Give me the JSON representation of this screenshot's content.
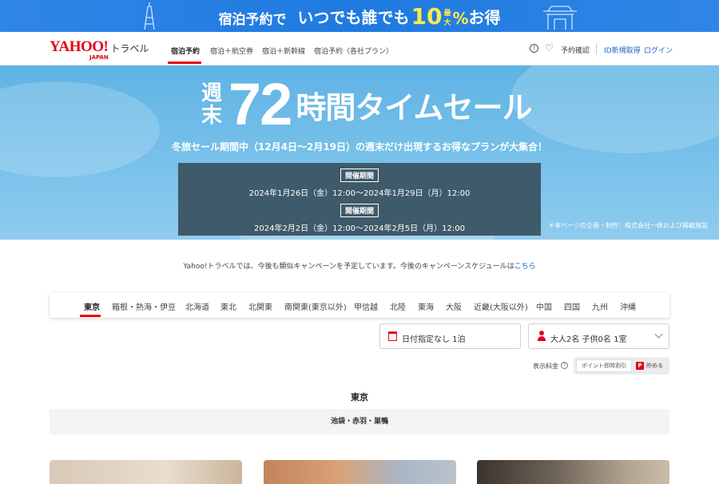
{
  "promo": {
    "text_a": "宿泊予約で",
    "text_b": "いつでも誰でも",
    "number": "10",
    "max_label_1": "最",
    "max_label_2": "大",
    "percent": "%",
    "suffix": "お得"
  },
  "nav": {
    "logo_text": "YAHOO!",
    "logo_sub": "JAPAN",
    "logo_service": "トラベル",
    "tabs": [
      "宿泊予約",
      "宿泊＋航空券",
      "宿泊＋新幹線",
      "宿泊予約（各社プラン）"
    ],
    "reservation_check": "予約確認",
    "register": "ID新規取得",
    "login": "ログイン"
  },
  "hero": {
    "week_1": "週",
    "week_2": "末",
    "hours": "72",
    "sale": "時間タイムセール",
    "subtitle": "冬旅セール期間中（12月4日～2月19日）の週末だけ出現するお得なプランが大集合！",
    "period_label": "開催期間",
    "period_1": "2024年1月26日（金）12:00～2024年1月29日（月）12:00",
    "period_2": "2024年2月2日（金）12:00～2024年2月5日（月）12:00",
    "note": "＊本ページの企画・制作：株式会社一休および掲載施設"
  },
  "notice": {
    "text": "Yahoo!トラベルでは、今後も類似キャンペーンを予定しています。今後のキャンペーンスケジュールは",
    "link": "こちら"
  },
  "regions": [
    "東京",
    "箱根・熱海・伊豆",
    "北海道",
    "東北",
    "北関東",
    "南関東(東京以外)",
    "甲信越",
    "北陸",
    "東海",
    "大阪",
    "近畿(大阪以外)",
    "中国",
    "四国",
    "九州",
    "沖縄"
  ],
  "search": {
    "date": "日付指定なし 1泊",
    "guests": "大人2名 子供0名 1室"
  },
  "price": {
    "label": "表示料金",
    "option_a": "ポイント即時割引",
    "option_b": "貯める",
    "badge": "P"
  },
  "section": {
    "title": "東京",
    "area": "池袋・赤羽・巣鴨"
  },
  "colors": {
    "brand_red": "#e60012",
    "link_blue": "#1a64c8",
    "promo_blue": "#1f7ae0",
    "hero_sky": "#6cb9e7",
    "period_bg": "#3f5a6a"
  }
}
